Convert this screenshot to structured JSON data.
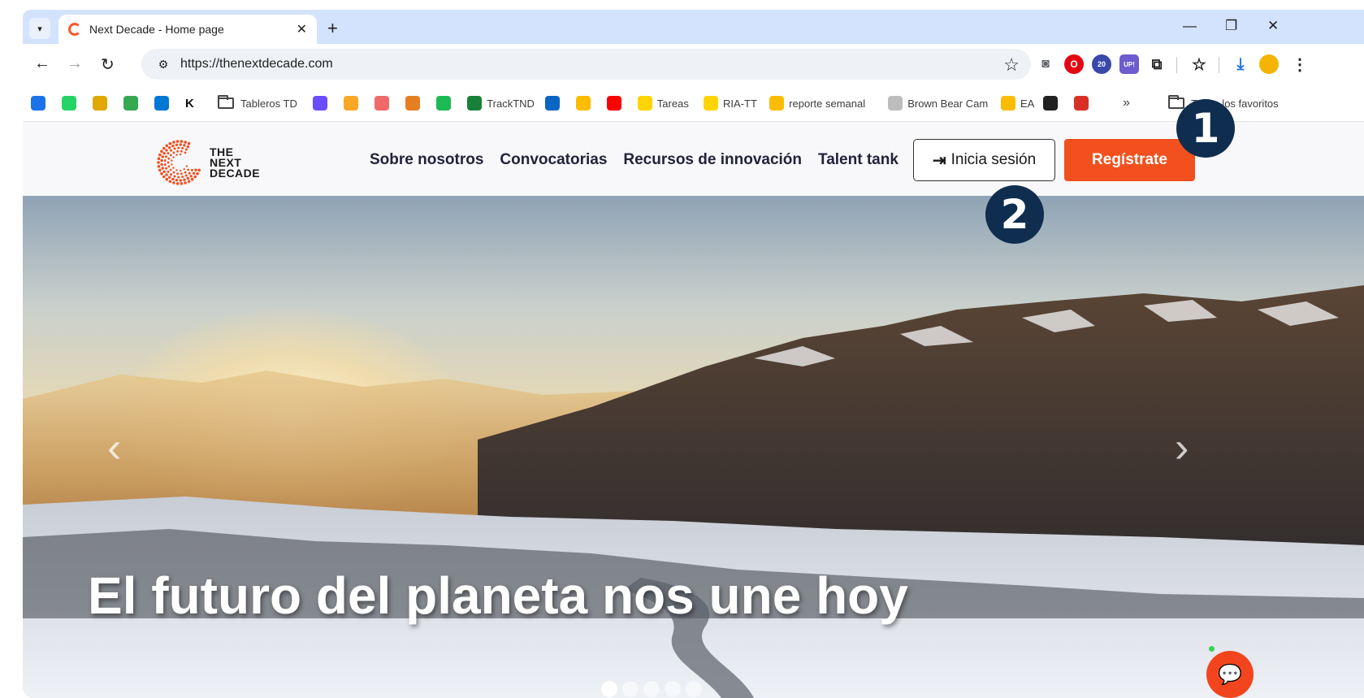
{
  "browser": {
    "tab_title": "Next Decade - Home page",
    "tab_close": "✕",
    "new_tab": "+",
    "url": "https://thenextdecade.com",
    "extension_badge": "20",
    "extension_up_label": "UP!"
  },
  "bookmarks": {
    "items": [
      {
        "label": "",
        "color": "#1a73e8"
      },
      {
        "label": "",
        "color": "#25d366"
      },
      {
        "label": "",
        "color": "#e0a800"
      },
      {
        "label": "",
        "color": "#34a853"
      },
      {
        "label": "",
        "color": "#0078d4"
      },
      {
        "label": "K",
        "color": "#e53935"
      },
      {
        "label": "Tableros TD",
        "folder": true
      },
      {
        "label": "",
        "color": "#6b4cff"
      },
      {
        "label": "",
        "color": "#f9a825"
      },
      {
        "label": "",
        "color": "#f06a6a"
      },
      {
        "label": "",
        "color": "#e67e22"
      },
      {
        "label": "",
        "color": "#1db954"
      },
      {
        "label": "TrackTND",
        "color": "#188038"
      },
      {
        "label": "",
        "color": "#0a66c2"
      },
      {
        "label": "",
        "color": "#fbbc04"
      },
      {
        "label": "",
        "color": "#ff0000"
      },
      {
        "label": "Tareas",
        "color": "#ffd400"
      },
      {
        "label": "RIA-TT",
        "color": "#ffd400"
      },
      {
        "label": "reporte semanal",
        "color": "#fbbc04"
      },
      {
        "label": "Brown Bear Cam",
        "color": "#bdbdbd"
      },
      {
        "label": "EA",
        "color": "#fbbc04"
      },
      {
        "label": "",
        "color": "#222222"
      },
      {
        "label": "",
        "color": "#d93025"
      }
    ],
    "overflow": "»",
    "all_bookmarks": "Todos los favoritos"
  },
  "site": {
    "logo_lines": [
      "THE",
      "NEXT",
      "DECADE"
    ],
    "nav": [
      "Sobre nosotros",
      "Convocatorias",
      "Recursos de innovación",
      "Talent tank"
    ],
    "login_label": "Inicia sesión",
    "register_label": "Regístrate",
    "brand_color": "#f2501e"
  },
  "hero": {
    "headline": "El futuro del planeta nos une hoy",
    "slides": 5,
    "active_slide": 1,
    "prev_icon": "chevron-left",
    "next_icon": "chevron-right"
  },
  "annotations": [
    "1",
    "2"
  ]
}
